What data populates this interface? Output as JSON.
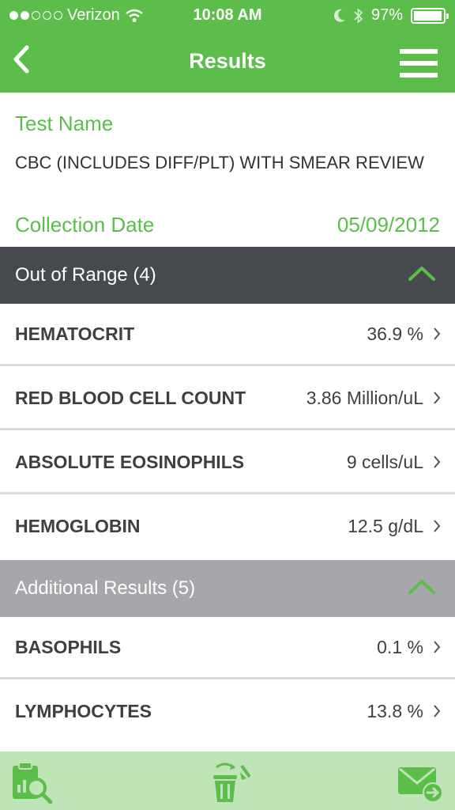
{
  "status": {
    "carrier": "Verizon",
    "time": "10:08 AM",
    "battery": "97%",
    "signal_dots_filled": 2,
    "signal_dots_total": 5,
    "battery_level": 0.97
  },
  "nav": {
    "title": "Results"
  },
  "info": {
    "test_name_label": "Test Name",
    "test_name": "CBC (INCLUDES DIFF/PLT) WITH SMEAR REVIEW",
    "collection_date_label": "Collection Date",
    "collection_date": "05/09/2012"
  },
  "out_of_range": {
    "title": "Out of Range (4)",
    "rows": [
      {
        "name": "HEMATOCRIT",
        "value": "36.9 %"
      },
      {
        "name": "RED BLOOD CELL COUNT",
        "value": "3.86 Million/uL"
      },
      {
        "name": "ABSOLUTE EOSINOPHILS",
        "value": "9 cells/uL"
      },
      {
        "name": "HEMOGLOBIN",
        "value": "12.5 g/dL"
      }
    ]
  },
  "additional": {
    "title": "Additional Results (5)",
    "rows": [
      {
        "name": "BASOPHILS",
        "value": "0.1 %"
      },
      {
        "name": "LYMPHOCYTES",
        "value": "13.8 %"
      }
    ]
  },
  "colors": {
    "brand_green": "#5cbd4b",
    "section_dark": "#464a4f",
    "section_gray": "#a5a7aa",
    "footer_bg": "#bfe4b8"
  },
  "icons": {
    "back": "chevron-left-icon",
    "menu": "hamburger-menu-icon",
    "section_toggle": "chevron-up-icon",
    "row_arrow": "chevron-right-icon",
    "footer": [
      "clipboard-search-icon",
      "trash-icon",
      "email-forward-icon"
    ]
  }
}
